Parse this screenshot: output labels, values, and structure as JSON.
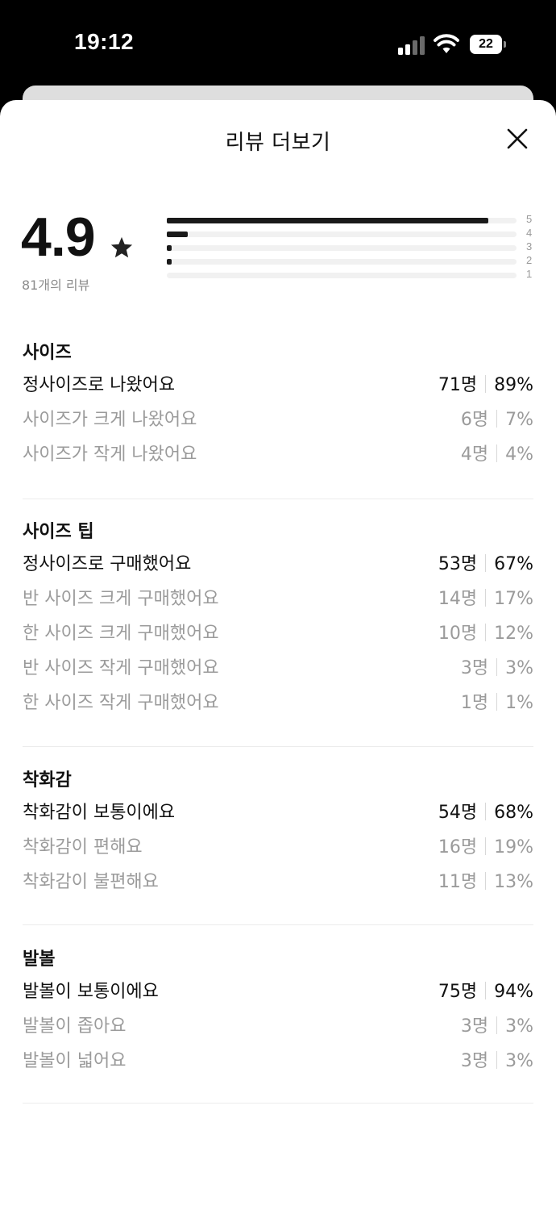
{
  "status_bar": {
    "time": "19:12",
    "battery": "22"
  },
  "sheet": {
    "title": "리뷰 더보기"
  },
  "summary": {
    "rating": "4.9",
    "review_count_text": "81개의 리뷰",
    "distribution": [
      {
        "label": "5",
        "fraction": 0.92
      },
      {
        "label": "4",
        "fraction": 0.06
      },
      {
        "label": "3",
        "fraction": 0.012
      },
      {
        "label": "2",
        "fraction": 0.012
      },
      {
        "label": "1",
        "fraction": 0
      }
    ]
  },
  "sections": [
    {
      "title": "사이즈",
      "options": [
        {
          "label": "정사이즈로 나왔어요",
          "count": "71명",
          "percent": "89%"
        },
        {
          "label": "사이즈가 크게 나왔어요",
          "count": "6명",
          "percent": "7%"
        },
        {
          "label": "사이즈가 작게 나왔어요",
          "count": "4명",
          "percent": "4%"
        }
      ]
    },
    {
      "title": "사이즈 팁",
      "options": [
        {
          "label": "정사이즈로 구매했어요",
          "count": "53명",
          "percent": "67%"
        },
        {
          "label": "반 사이즈 크게 구매했어요",
          "count": "14명",
          "percent": "17%"
        },
        {
          "label": "한 사이즈 크게 구매했어요",
          "count": "10명",
          "percent": "12%"
        },
        {
          "label": "반 사이즈 작게 구매했어요",
          "count": "3명",
          "percent": "3%"
        },
        {
          "label": "한 사이즈 작게 구매했어요",
          "count": "1명",
          "percent": "1%"
        }
      ]
    },
    {
      "title": "착화감",
      "options": [
        {
          "label": "착화감이 보통이에요",
          "count": "54명",
          "percent": "68%"
        },
        {
          "label": "착화감이 편해요",
          "count": "16명",
          "percent": "19%"
        },
        {
          "label": "착화감이 불편해요",
          "count": "11명",
          "percent": "13%"
        }
      ]
    },
    {
      "title": "발볼",
      "options": [
        {
          "label": "발볼이 보통이에요",
          "count": "75명",
          "percent": "94%"
        },
        {
          "label": "발볼이 좁아요",
          "count": "3명",
          "percent": "3%"
        },
        {
          "label": "발볼이 넓어요",
          "count": "3명",
          "percent": "3%"
        }
      ]
    }
  ]
}
